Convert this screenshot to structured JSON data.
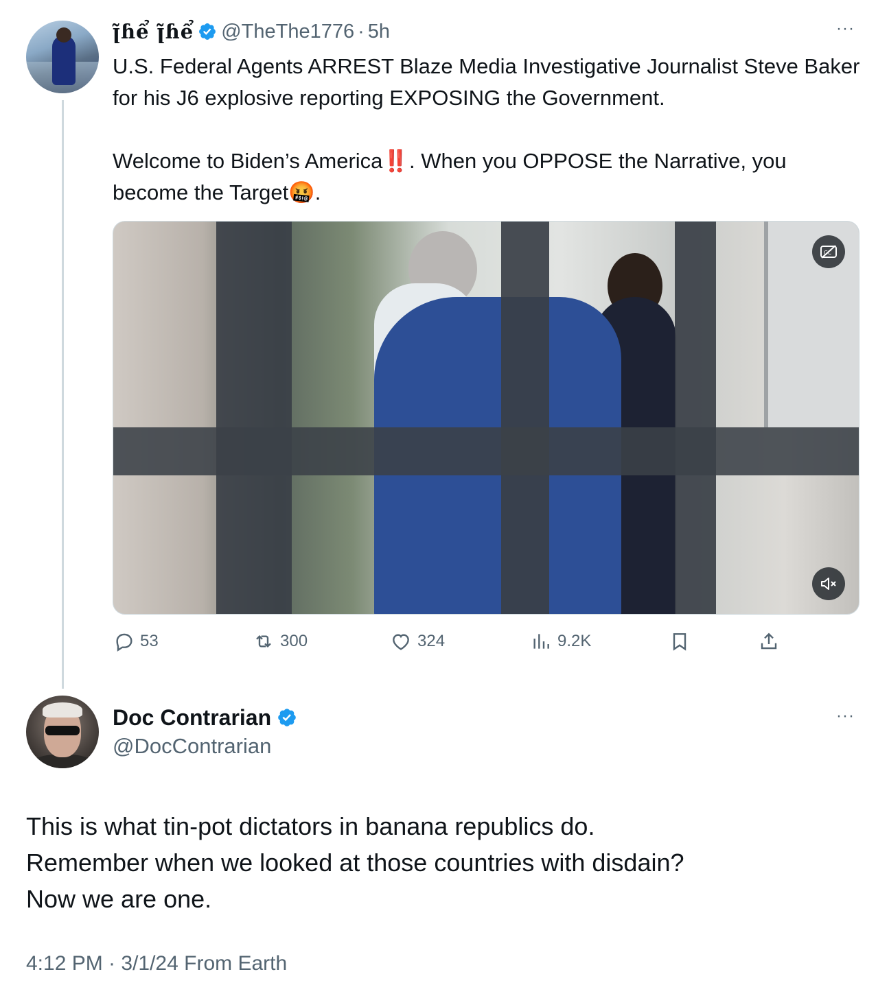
{
  "colors": {
    "verified": "#1d9bf0",
    "muted_text": "#536471",
    "primary_text": "#0f1419",
    "thread_line": "#cfd9de"
  },
  "tweet1": {
    "display_name": "ꞁ̃ɦể ꞁ̃ɦể",
    "handle": "@TheThe1776",
    "separator": "·",
    "time": "5h",
    "more": "···",
    "text": "U.S. Federal Agents ARREST Blaze Media Investigative Journalist Steve Baker for his J6 explosive reporting EXPOSING the Government.\n\nWelcome to Biden’s America‼️. When you OPPOSE the Narrative, you become the Target🤬.",
    "media": {
      "captions_icon": "captions-off-icon",
      "mute_icon": "muted-speaker-icon"
    },
    "actions": {
      "replies": "53",
      "reposts": "300",
      "likes": "324",
      "views": "9.2K"
    }
  },
  "tweet2": {
    "display_name": "Doc Contrarian",
    "handle": "@DocContrarian",
    "more": "···",
    "text": "This is what tin-pot dictators in banana republics do.\nRemember when we looked at those countries with disdain?\nNow we are one.",
    "meta": "4:12 PM · 3/1/24 From Earth"
  }
}
